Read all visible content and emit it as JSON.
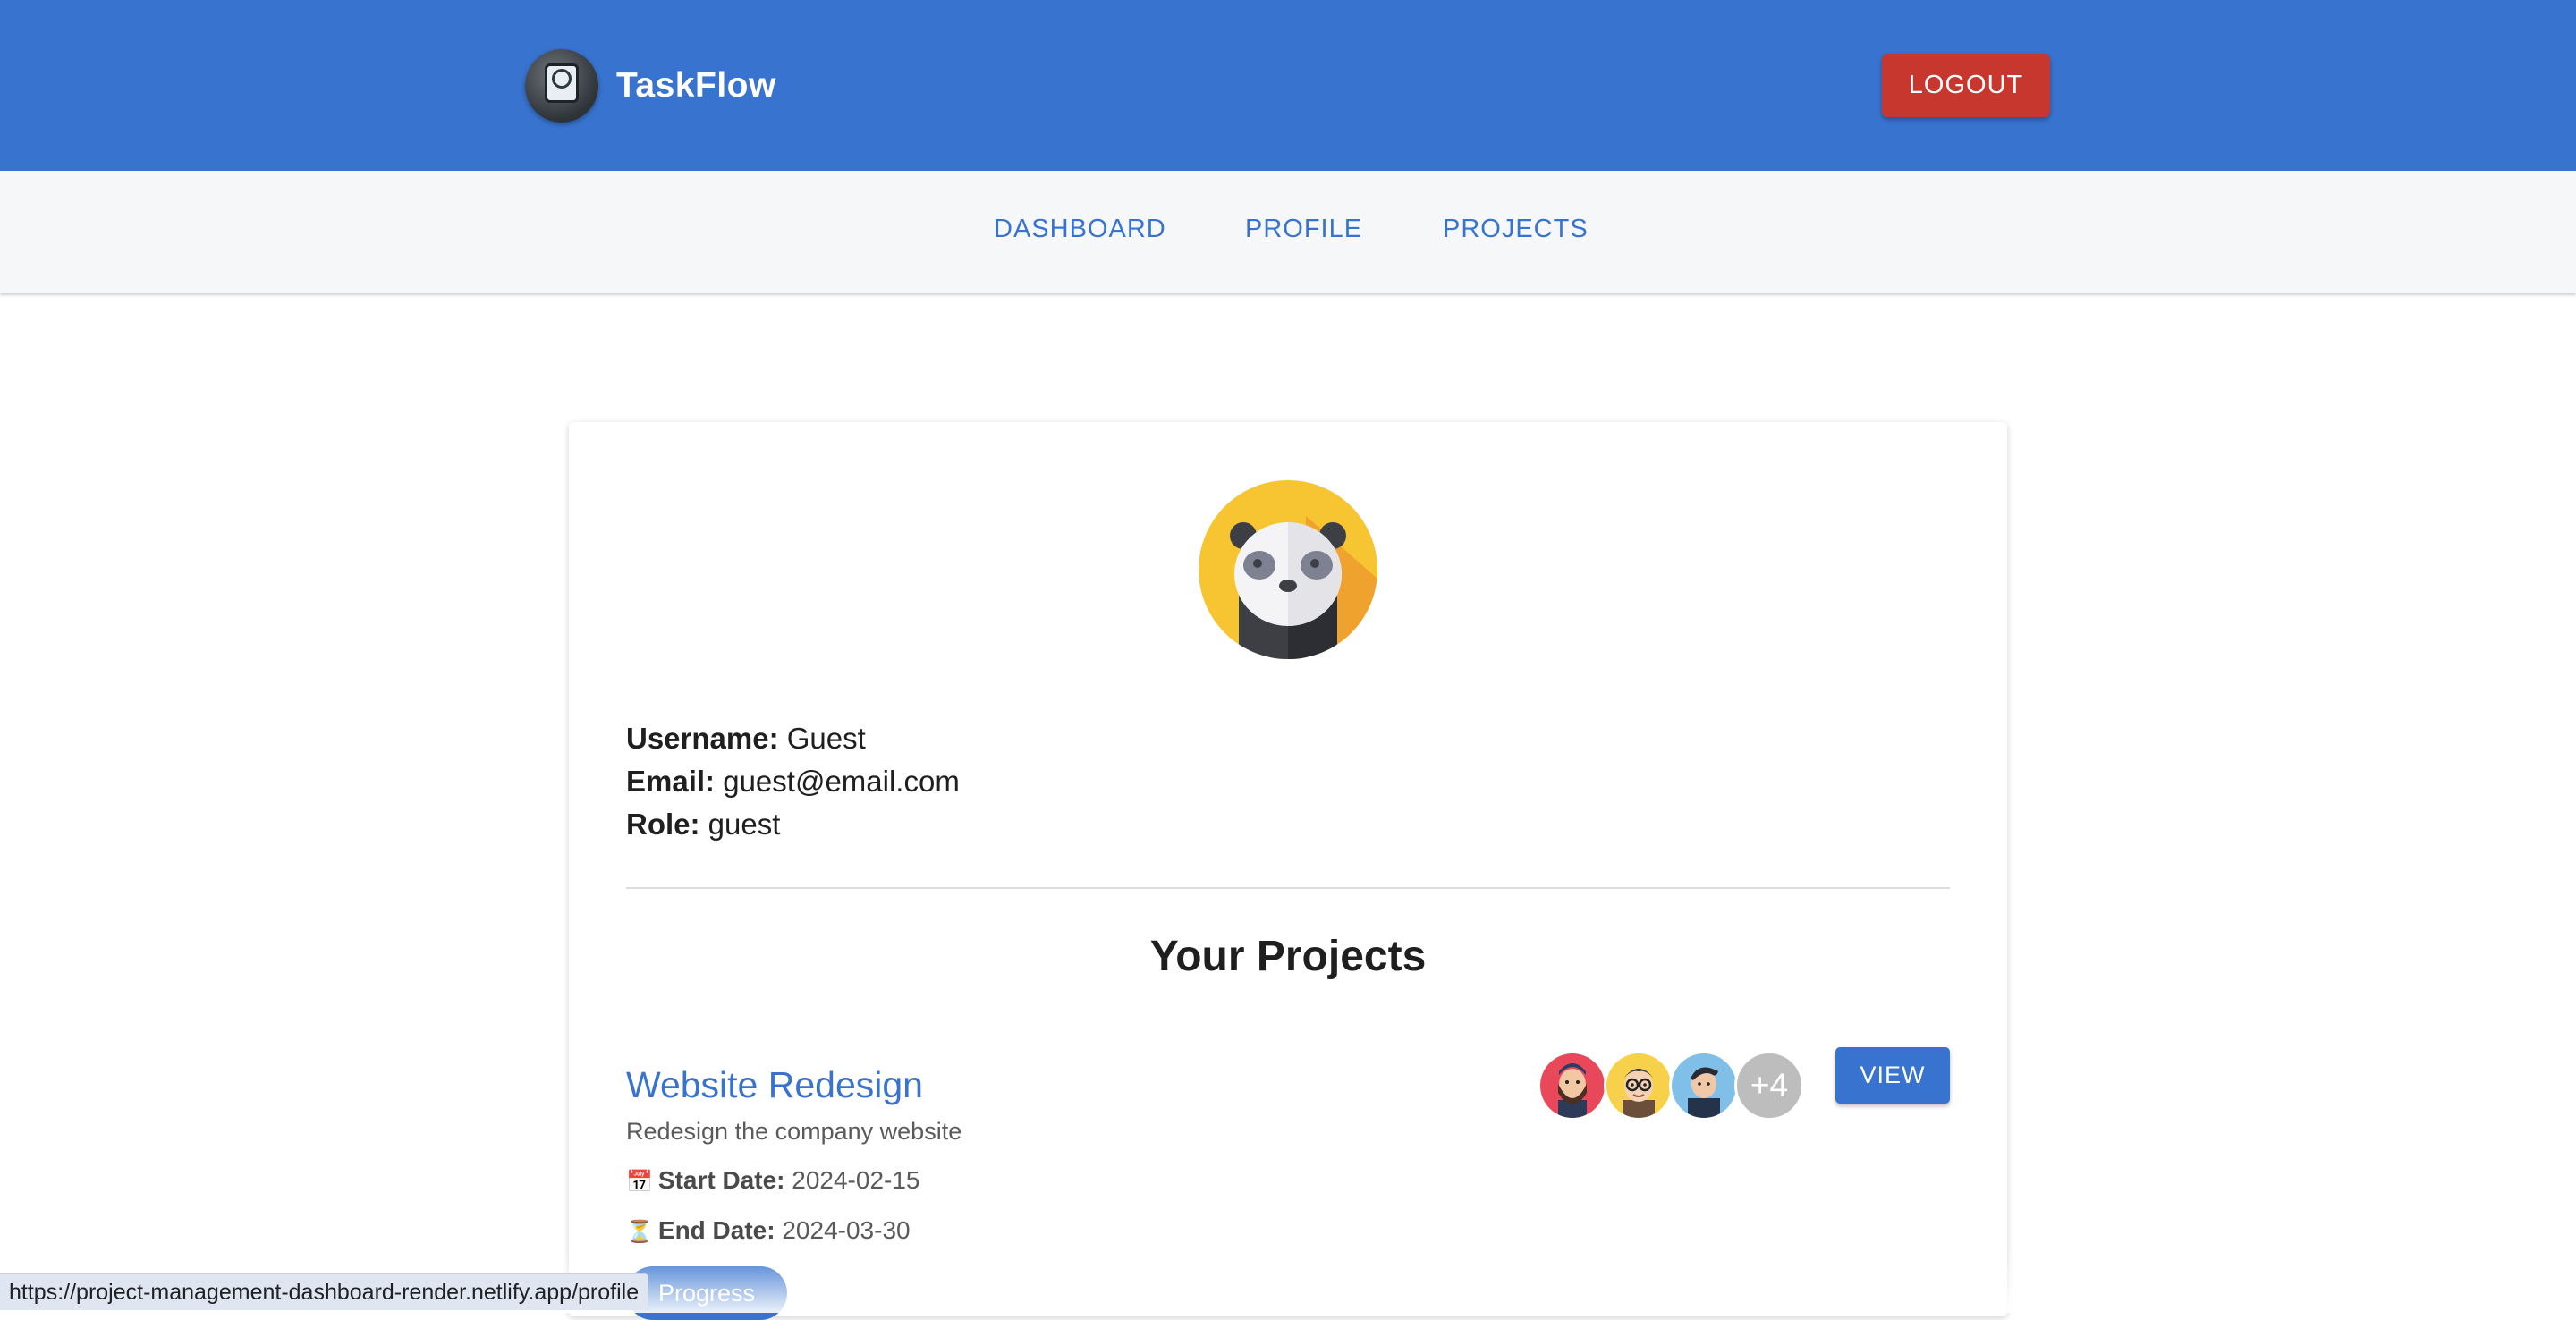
{
  "header": {
    "brand_name": "TaskFlow",
    "logo_icon": "app-logo-icon",
    "logout_label": "LOGOUT",
    "background_color": "#3874cf",
    "logout_color": "#c8372e"
  },
  "nav": {
    "items": [
      {
        "label": "DASHBOARD"
      },
      {
        "label": "PROFILE"
      },
      {
        "label": "PROJECTS"
      }
    ]
  },
  "profile": {
    "avatar_icon": "panda-avatar-icon",
    "username_label": "Username:",
    "username": "Guest",
    "email_label": "Email:",
    "email": "guest@email.com",
    "role_label": "Role:",
    "role": "guest"
  },
  "projects": {
    "title": "Your Projects",
    "items": [
      {
        "name": "Website Redesign",
        "description": "Redesign the company website",
        "start_icon": "📅",
        "start_label": "Start Date:",
        "start_date": "2024-02-15",
        "end_icon": "⏳",
        "end_label": "End Date:",
        "end_date": "2024-03-30",
        "status": "Progress",
        "extra_members": "+4",
        "view_label": "VIEW"
      }
    ]
  },
  "status_bar": {
    "url": "https://project-management-dashboard-render.netlify.app/profile"
  }
}
